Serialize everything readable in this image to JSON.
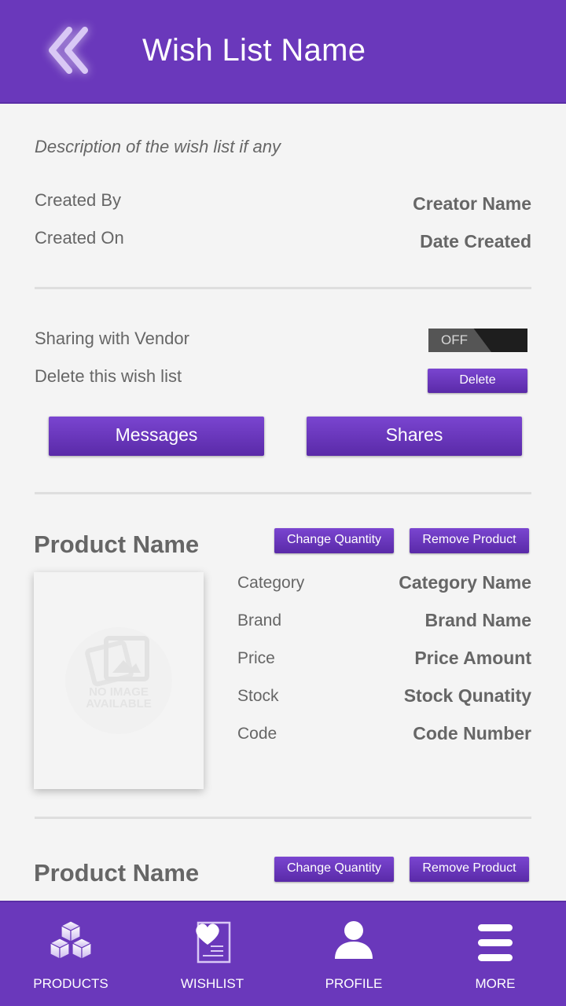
{
  "header": {
    "title": "Wish List Name"
  },
  "wishlist": {
    "description": "Description of the wish list if any",
    "created_by_label": "Created By",
    "created_by_value": "Creator Name",
    "created_on_label": "Created On",
    "created_on_value": "Date Created",
    "sharing_label": "Sharing with Vendor",
    "sharing_toggle": "OFF",
    "delete_label": "Delete this wish list",
    "delete_button": "Delete",
    "messages_button": "Messages",
    "shares_button": "Shares"
  },
  "products": [
    {
      "name": "Product Name",
      "change_quantity": "Change Quantity",
      "remove_product": "Remove Product",
      "image_placeholder": "NO IMAGE AVAILABLE",
      "details": [
        {
          "label": "Category",
          "value": "Category Name"
        },
        {
          "label": "Brand",
          "value": "Brand Name"
        },
        {
          "label": "Price",
          "value": "Price Amount"
        },
        {
          "label": "Stock",
          "value": "Stock Qunatity"
        },
        {
          "label": "Code",
          "value": "Code Number"
        }
      ]
    },
    {
      "name": "Product Name",
      "change_quantity": "Change Quantity",
      "remove_product": "Remove Product"
    }
  ],
  "bottom_nav": [
    {
      "label": "PRODUCTS",
      "icon": "boxes-icon"
    },
    {
      "label": "WISHLIST",
      "icon": "heart-list-icon"
    },
    {
      "label": "PROFILE",
      "icon": "user-icon"
    },
    {
      "label": "MORE",
      "icon": "menu-icon"
    }
  ],
  "colors": {
    "brand": "#6a38bb",
    "button": "#6334b4",
    "background": "#f4f4f4"
  }
}
